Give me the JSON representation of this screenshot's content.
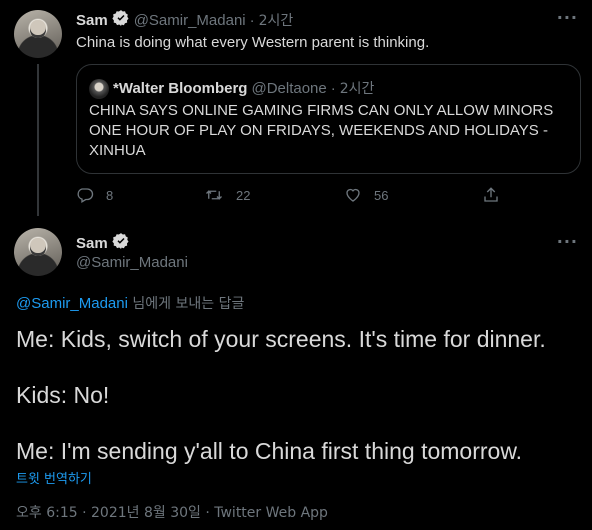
{
  "tweet1": {
    "name": "Sam",
    "handle": "@Samir_Madani",
    "dot": "·",
    "time": "2시간",
    "text": "China is doing what every Western parent is thinking.",
    "quote": {
      "name": "*Walter Bloomberg",
      "handle": "@Deltaone",
      "dot": "·",
      "time": "2시간",
      "text": "CHINA SAYS ONLINE GAMING FIRMS CAN ONLY ALLOW MINORS ONE HOUR OF PLAY ON FRIDAYS, WEEKENDS AND HOLIDAYS - XINHUA"
    },
    "actions": {
      "replies": "8",
      "retweets": "22",
      "likes": "56"
    }
  },
  "tweet2": {
    "name": "Sam",
    "handle": "@Samir_Madani",
    "reply_link": "@Samir_Madani",
    "reply_suffix": " 님에게 보내는 답글",
    "lines": [
      "Me: Kids, switch of your screens. It's time for dinner.",
      "Kids: No!",
      "Me: I'm sending y'all to China first thing tomorrow."
    ],
    "translate": "트윗 번역하기",
    "meta": "오후 6:15 · 2021년 8월 30일 · Twitter Web App"
  },
  "icons": {
    "verified": "verified-badge-icon",
    "more": "more-options-icon",
    "reply": "reply-icon",
    "retweet": "retweet-icon",
    "like": "heart-icon",
    "share": "share-icon"
  },
  "colors": {
    "background": "#000000",
    "text": "#d9d9d9",
    "muted": "#6e767d",
    "accent": "#1d9bf0",
    "border": "#2f3336"
  }
}
